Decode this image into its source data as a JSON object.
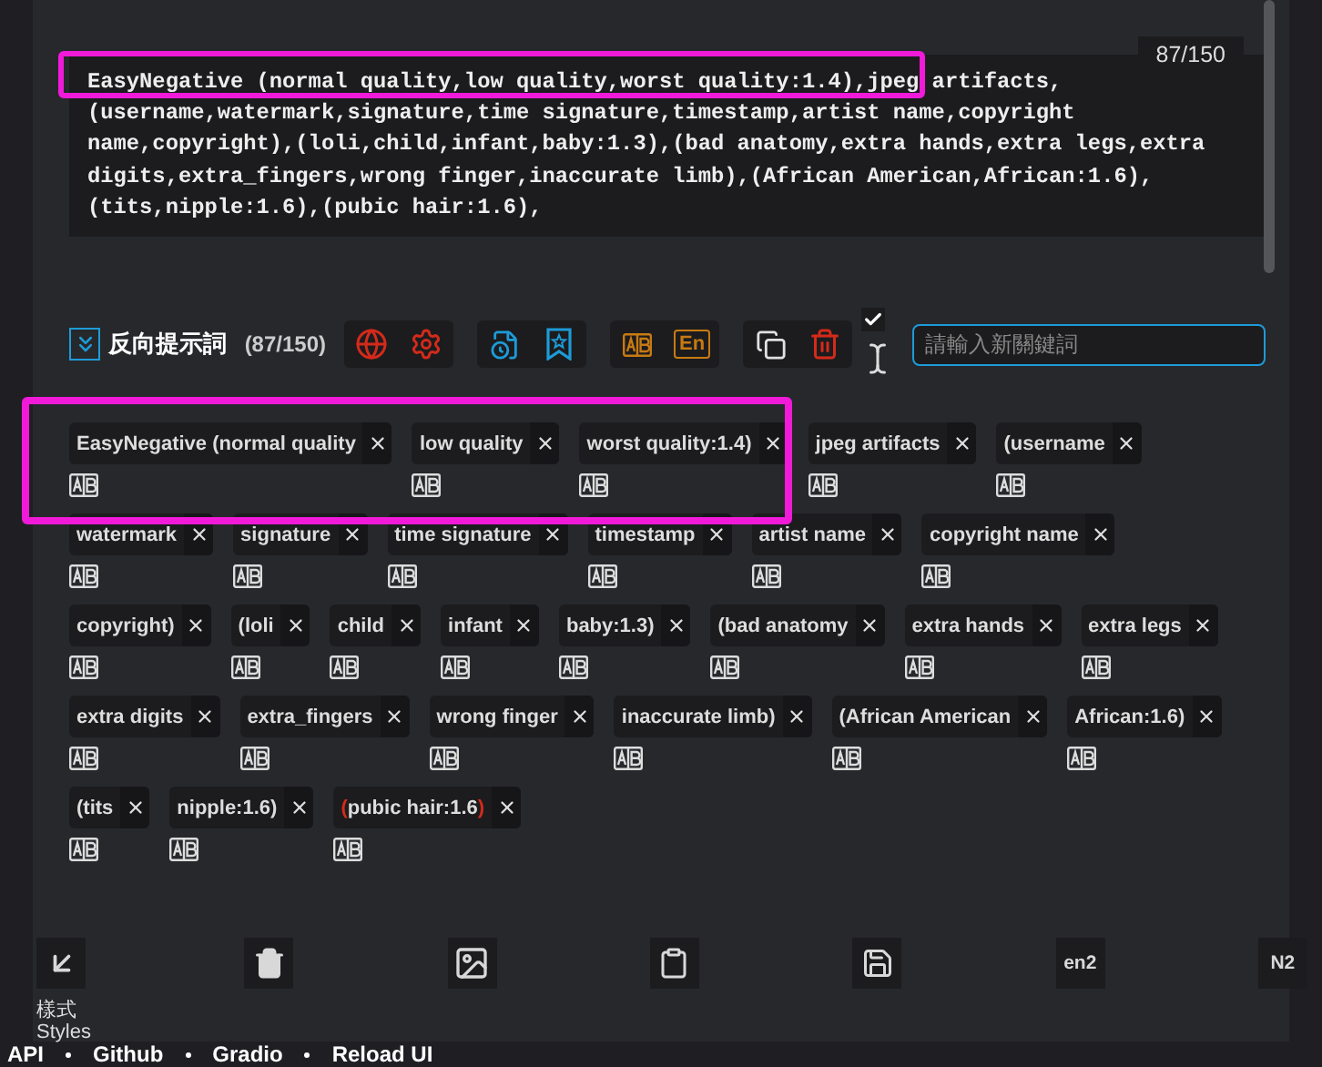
{
  "prompt": {
    "counter": "87/150",
    "lines": [
      "EasyNegative (normal quality,low quality,worst quality:1.4),jpeg artifacts,",
      "(username,watermark,signature,time signature,timestamp,artist name,copyright",
      "name,copyright),(loli,child,infant,baby:1.3),(bad anatomy,extra hands,extra legs,extra",
      "digits,extra_fingers,wrong finger,inaccurate limb),(African American,African:1.6),",
      "(tits,nipple:1.6),(pubic hair:1.6),"
    ]
  },
  "toolbar": {
    "title": "反向提示詞",
    "count": "(87/150)",
    "expanded": true,
    "groups": [
      [
        {
          "kind": "globe",
          "color": "#d42a1a"
        },
        {
          "kind": "gear",
          "color": "#d42a1a"
        }
      ],
      [
        {
          "kind": "history",
          "color": "#1d9bd8"
        },
        {
          "kind": "bookmark",
          "color": "#1d9bd8"
        }
      ],
      [
        {
          "kind": "translate",
          "color": "#c77a12"
        },
        {
          "kind": "label",
          "label": "En",
          "color": "#c77a12"
        }
      ],
      [
        {
          "kind": "copy",
          "color": "#e0e0e0"
        },
        {
          "kind": "trash",
          "color": "#d42a1a"
        }
      ]
    ],
    "auto_checked": true,
    "keyword_placeholder": "請輸入新關鍵詞"
  },
  "tags": [
    {
      "text": "EasyNegative (normal quality",
      "error": false
    },
    {
      "text": "low quality",
      "error": false
    },
    {
      "text": "worst quality:1.4)",
      "error": false
    },
    {
      "text": "jpeg artifacts",
      "error": false
    },
    {
      "text": "(username",
      "error": false
    },
    {
      "text": "watermark",
      "error": false
    },
    {
      "text": "signature",
      "error": false
    },
    {
      "text": "time signature",
      "error": false
    },
    {
      "text": "timestamp",
      "error": false
    },
    {
      "text": "artist name",
      "error": false
    },
    {
      "text": "copyright name",
      "error": false
    },
    {
      "text": "copyright)",
      "error": false
    },
    {
      "text": "(loli",
      "error": false
    },
    {
      "text": "child",
      "error": false
    },
    {
      "text": "infant",
      "error": false
    },
    {
      "text": "baby:1.3)",
      "error": false
    },
    {
      "text": "(bad anatomy",
      "error": false
    },
    {
      "text": "extra hands",
      "error": false
    },
    {
      "text": "extra legs",
      "error": false
    },
    {
      "text": "extra digits",
      "error": false
    },
    {
      "text": "extra_fingers",
      "error": false
    },
    {
      "text": "wrong finger",
      "error": false
    },
    {
      "text": "inaccurate limb)",
      "error": false
    },
    {
      "text": "(African American",
      "error": false
    },
    {
      "text": "African:1.6)",
      "error": false
    },
    {
      "text": "(tits",
      "error": false
    },
    {
      "text": "nipple:1.6)",
      "error": false
    },
    {
      "text": "(pubic hair:1.6)",
      "error": true
    }
  ],
  "bottom_buttons": [
    {
      "kind": "arrow",
      "caption": [
        "樣式",
        "Styles"
      ]
    },
    {
      "kind": "trash"
    },
    {
      "kind": "image"
    },
    {
      "kind": "clipboard"
    },
    {
      "kind": "save"
    },
    {
      "kind": "label",
      "label": "en2"
    },
    {
      "kind": "label",
      "label": "N2"
    }
  ],
  "footer": [
    "API",
    "Github",
    "Gradio",
    "Reload UI"
  ],
  "highlights": {
    "prompt_line": true,
    "tags": true
  }
}
